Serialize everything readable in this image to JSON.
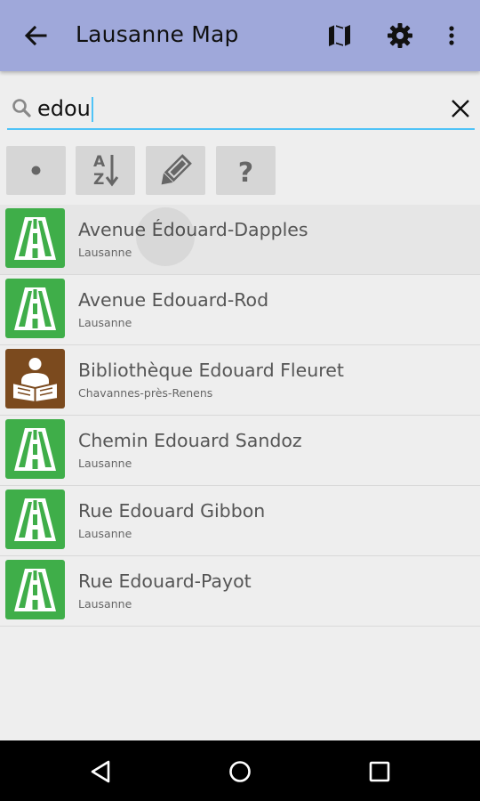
{
  "app": {
    "title": "Lausanne Map",
    "accent": "#9fa8da"
  },
  "actions": {
    "back_icon": "arrow-back-icon",
    "map_icon": "map-icon",
    "settings_icon": "gear-icon",
    "overflow_icon": "more-vert-icon"
  },
  "search": {
    "query": "edou",
    "underline_color": "#4fc3f7"
  },
  "toolbar": [
    {
      "icon": "dot-icon"
    },
    {
      "icon": "sort-az-icon"
    },
    {
      "icon": "pencil-icon"
    },
    {
      "icon": "help-icon",
      "label": "?"
    }
  ],
  "results": [
    {
      "name": "Avenue Édouard-Dapples",
      "place": "Lausanne",
      "icon": "road-icon",
      "highlight": true
    },
    {
      "name": "Avenue Edouard-Rod",
      "place": "Lausanne",
      "icon": "road-icon"
    },
    {
      "name": "Bibliothèque Edouard Fleuret",
      "place": "Chavannes-près-Renens",
      "icon": "library-icon"
    },
    {
      "name": "Chemin Edouard Sandoz",
      "place": "Lausanne",
      "icon": "road-icon"
    },
    {
      "name": "Rue Edouard Gibbon",
      "place": "Lausanne",
      "icon": "road-icon"
    },
    {
      "name": "Rue Edouard-Payot",
      "place": "Lausanne",
      "icon": "road-icon"
    }
  ],
  "colors": {
    "road": "#3fae49",
    "library": "#7b4a1e"
  },
  "navbar": [
    "back-triangle-icon",
    "home-circle-icon",
    "recents-square-icon"
  ]
}
